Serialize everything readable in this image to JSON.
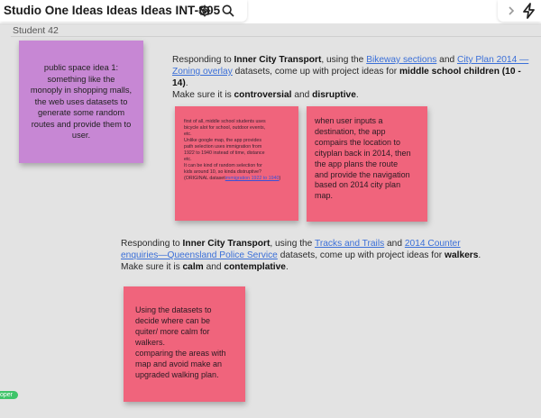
{
  "header": {
    "board_title": "Studio One Ideas Ideas Ideas INT-S05",
    "icons": [
      "settings-gear-icon",
      "search-icon",
      "chevron-right-icon",
      "lightning-icon"
    ]
  },
  "canvas": {
    "frame_label": "Student 42"
  },
  "prompt1": {
    "pre": "Responding to ",
    "topic": "Inner City Transport",
    "mid1": ", using the ",
    "link1": "Bikeway sections",
    "and": " and ",
    "link2a": "City Plan 2014 —",
    "link2b": "Zoning overlay",
    "mid2": " datasets, come up with project ideas for ",
    "audience": "middle school children (10 - 14)",
    "end": ".",
    "line3_pre": "Make sure it is ",
    "quality1": "controversial",
    "line3_and": " and ",
    "quality2": "disruptive",
    "line3_end": "."
  },
  "prompt2": {
    "pre": "Responding to ",
    "topic": "Inner City Transport",
    "mid1": ", using the ",
    "link1": "Tracks and Trails",
    "and": " and ",
    "link2a": "2014 Counter",
    "link2b": "enquiries—Queensland Police Service",
    "mid2": " datasets, come up with project ideas for ",
    "audience": "walkers",
    "end": ".",
    "line3_pre": "Make sure it is ",
    "quality1": "calm",
    "line3_and": " and ",
    "quality2": "contemplative",
    "line3_end": "."
  },
  "stickies": {
    "purple": "public space idea 1:\nsomething like the\nmonoply in shopping malls,\nthe web uses datasets to\ngenerate some random\nroutes and provide them to\nuser.",
    "small_pink_text": "first of all, middle school students uses\nbicycle alot for school, outdoor events,\netc.\nUnlike google map, the app provides\npath selection uses immigration from\n1922 to 1940 instead of time, distance\netc.\nIt can be kind of random selection for\nkids around 10, so kinda distruptive?\n(ORIGINAL dataset",
    "small_pink_link": "immigration 1922 to 1940",
    "small_pink_end": ")",
    "pink_right": "when user inputs a\ndestination, the app\ncompairs the location to\ncityplan back in 2014, then\n the app plans the route\nand provide the navigation\nbased on 2014 city plan\nmap.",
    "pink_bottom": "Using the datasets to\ndecide where can be\nquiter/ more calm for\nwalkers.\ncomparing the areas with\nmap and avoid make an\nupgraded walking plan."
  },
  "badge": "oper",
  "colors": {
    "canvas": "#e3e3e3",
    "purple_sticky": "#c787d4",
    "pink_sticky": "#f0647c",
    "link": "#3a6fd8",
    "badge": "#3fc46a"
  }
}
